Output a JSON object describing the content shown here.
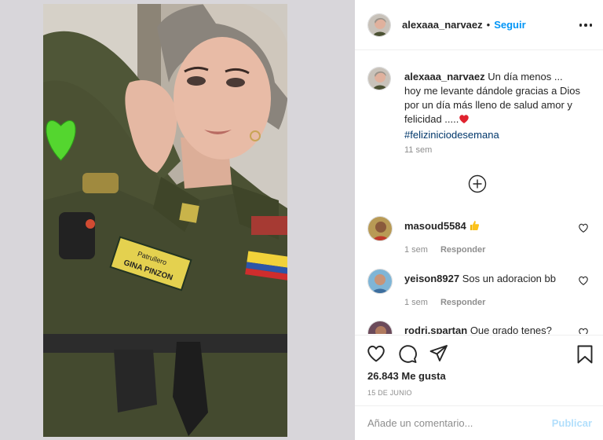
{
  "post": {
    "username": "alexaaa_narvaez",
    "follow_label": "Seguir",
    "separator": "•",
    "more_icon": "more-options-icon",
    "accent_color": "#0095f6"
  },
  "caption": {
    "username": "alexaaa_narvaez",
    "text": "Un día menos ... hoy me levante dándole gracias a Dios por un día más lleno de salud amor y felicidad .....",
    "emoji": "red-heart",
    "hashtag": "#felizinicio​desemana",
    "time": "11 sem"
  },
  "comments": [
    {
      "username": "masoud5584",
      "text": "",
      "emoji": "thumbs-up",
      "time": "1 sem",
      "reply_label": "Responder"
    },
    {
      "username": "yeison8927",
      "text": "Sos un adoracion bb",
      "emoji": "",
      "time": "1 sem",
      "reply_label": "Responder"
    },
    {
      "username": "rodri.spartan",
      "text": "Que grado tenes?",
      "emoji": "",
      "time": "",
      "reply_label": ""
    }
  ],
  "actions": {
    "icons": [
      "heart-icon",
      "comment-icon",
      "share-icon",
      "save-icon"
    ],
    "likes_label": "26.843 Me gusta",
    "date": "15 DE JUNIO"
  },
  "composer": {
    "placeholder": "Añade un comentario...",
    "publish_label": "Publicar",
    "publish_color": "#b2dffc"
  },
  "photo": {
    "overlay_sticker": "green-heart",
    "patch_text": "Patrullero GINA PINZON"
  }
}
